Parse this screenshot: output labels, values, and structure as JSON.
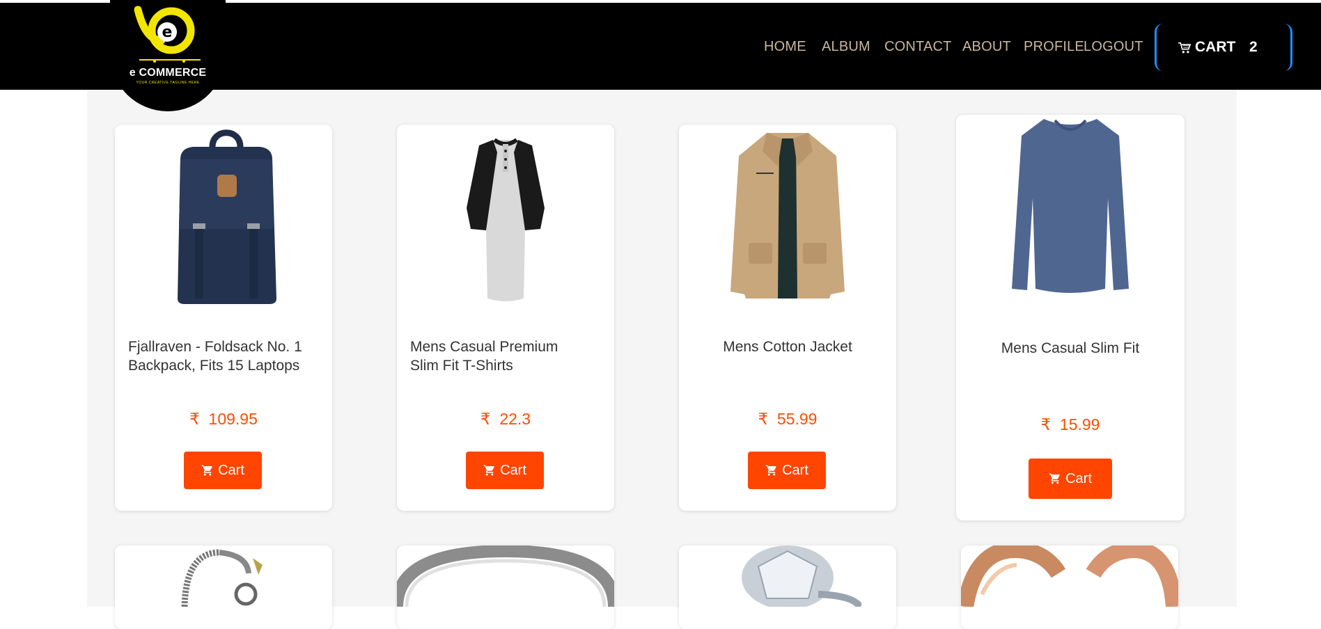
{
  "brand": {
    "logo_text": "e COMMERCE",
    "tagline": "YOUR CREATIVE TAGLINE HERE",
    "logo_icon": "e-logo-icon",
    "accent_yellow": "#f2e600"
  },
  "nav": {
    "items": [
      {
        "label": "HOME"
      },
      {
        "label": "ALBUM"
      },
      {
        "label": "CONTACT"
      },
      {
        "label": "ABOUT"
      },
      {
        "label": "PROFILE"
      },
      {
        "label": "LOGOUT"
      }
    ],
    "cart_label": "CART",
    "cart_count": "2",
    "cart_icon": "shopping-cart-icon",
    "link_color": "#c9b79c",
    "cart_border_color": "#1e90ff"
  },
  "products": [
    {
      "title_line1": "Fjallraven - Foldsack No. 1",
      "title_line2": "Backpack, Fits 15 Laptops",
      "currency": "₹",
      "price": "109.95",
      "button_label": "Cart",
      "image": "backpack-image"
    },
    {
      "title_line1": "Mens Casual Premium",
      "title_line2": "Slim Fit T-Shirts",
      "currency": "₹",
      "price": "22.3",
      "button_label": "Cart",
      "image": "raglan-tshirt-image"
    },
    {
      "title_line1": "Mens Cotton Jacket",
      "title_line2": "",
      "currency": "₹",
      "price": "55.99",
      "button_label": "Cart",
      "image": "cotton-jacket-image"
    },
    {
      "title_line1": "Mens Casual Slim Fit",
      "title_line2": "",
      "currency": "₹",
      "price": "15.99",
      "button_label": "Cart",
      "image": "longsleeve-shirt-image"
    }
  ],
  "second_row": [
    {
      "image": "chain-bracelet-image"
    },
    {
      "image": "silver-ring-image"
    },
    {
      "image": "diamond-ring-image"
    },
    {
      "image": "rose-gold-rings-image"
    }
  ],
  "colors": {
    "price": "#ff4d00",
    "button": "#ff4500",
    "content_bg": "#f5f5f5",
    "navbar": "#000000"
  }
}
